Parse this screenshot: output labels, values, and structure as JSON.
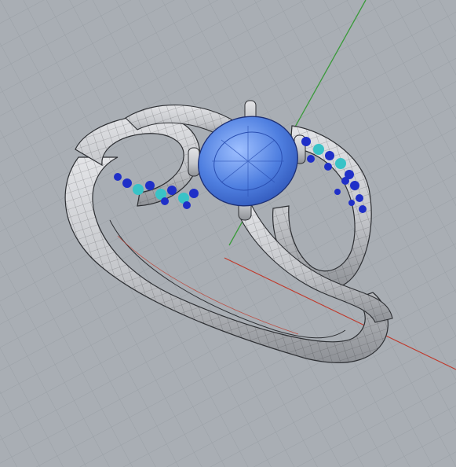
{
  "viewport": {
    "background": "#a9aeb4",
    "grid_color": "#9aa0a6",
    "grid_major_color": "#8d939a",
    "axis_x_color": "#c0392b",
    "axis_y_color": "#3a9a3a"
  },
  "model": {
    "metal_color": "#c9cbcf",
    "metal_shadow_color": "#8e9196",
    "wire_color": "#2d2f33",
    "center_stone_color": "#4f7fe0",
    "center_stone_highlight": "#9fc0ff",
    "accent_stone_blue": "#1f2fc8",
    "accent_stone_teal": "#39c3c7",
    "stones_in_view": 27,
    "prongs_in_view": 4
  }
}
